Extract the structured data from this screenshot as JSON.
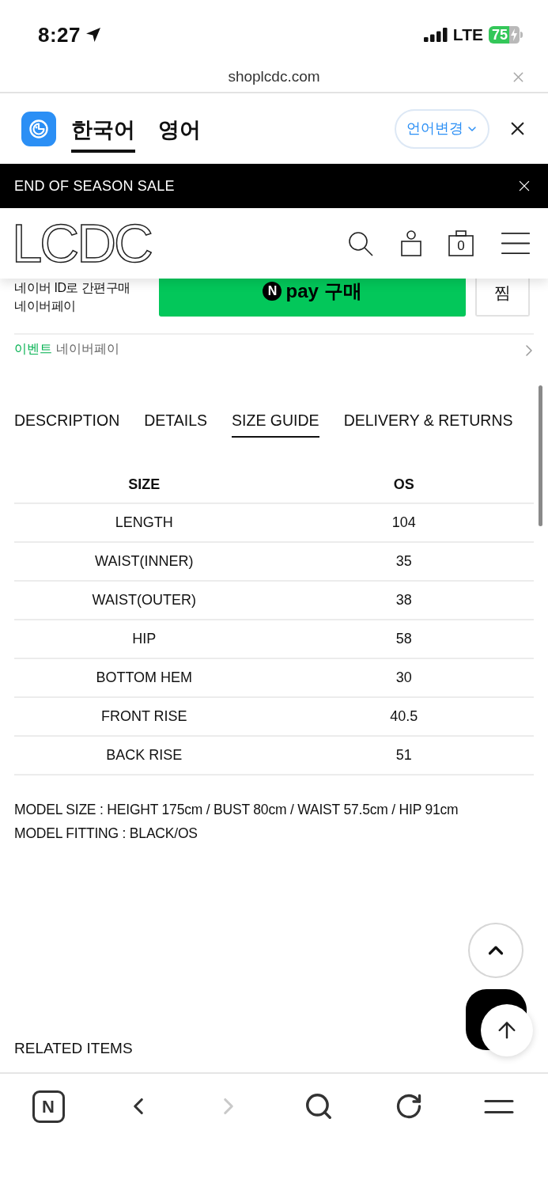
{
  "status_bar": {
    "time": "8:27",
    "network": "LTE",
    "battery": "75"
  },
  "url_bar": {
    "url": "shoplcdc.com"
  },
  "translate_bar": {
    "tabs": [
      {
        "label": "한국어",
        "selected": true
      },
      {
        "label": "영어",
        "selected": false
      }
    ],
    "change_button": "언어변경"
  },
  "promo_bar": {
    "text": "END OF SEASON SALE"
  },
  "header": {
    "logo": "LCDC",
    "cart_count": "0"
  },
  "naver_pay": {
    "caption_lines": [
      "네이버 ID로 간편구매",
      "네이버페이"
    ],
    "logo_letter": "N",
    "button_label": "pay 구매",
    "wish_button": "찜"
  },
  "event": {
    "tag": "이벤트",
    "text": "네이버페이"
  },
  "product_tabs": [
    {
      "label": "DESCRIPTION",
      "selected": false
    },
    {
      "label": "DETAILS",
      "selected": false
    },
    {
      "label": "SIZE GUIDE",
      "selected": true
    },
    {
      "label": "DELIVERY & RETURNS",
      "selected": false
    }
  ],
  "size_table": {
    "columns": [
      "SIZE",
      "OS"
    ],
    "rows": [
      [
        "LENGTH",
        "104"
      ],
      [
        "WAIST(INNER)",
        "35"
      ],
      [
        "WAIST(OUTER)",
        "38"
      ],
      [
        "HIP",
        "58"
      ],
      [
        "BOTTOM HEM",
        "30"
      ],
      [
        "FRONT RISE",
        "40.5"
      ],
      [
        "BACK RISE",
        "51"
      ]
    ]
  },
  "model_info": [
    "MODEL SIZE : HEIGHT 175cm / BUST 80cm / WAIST 57.5cm / HIP 91cm",
    "MODEL FITTING : BLACK/OS"
  ],
  "related": {
    "title": "RELATED ITEMS"
  },
  "browser_toolbar": {
    "app_badge": "N",
    "nav_buttons": [
      {
        "kind": "back",
        "disabled": false
      },
      {
        "kind": "forward",
        "disabled": true
      }
    ]
  }
}
